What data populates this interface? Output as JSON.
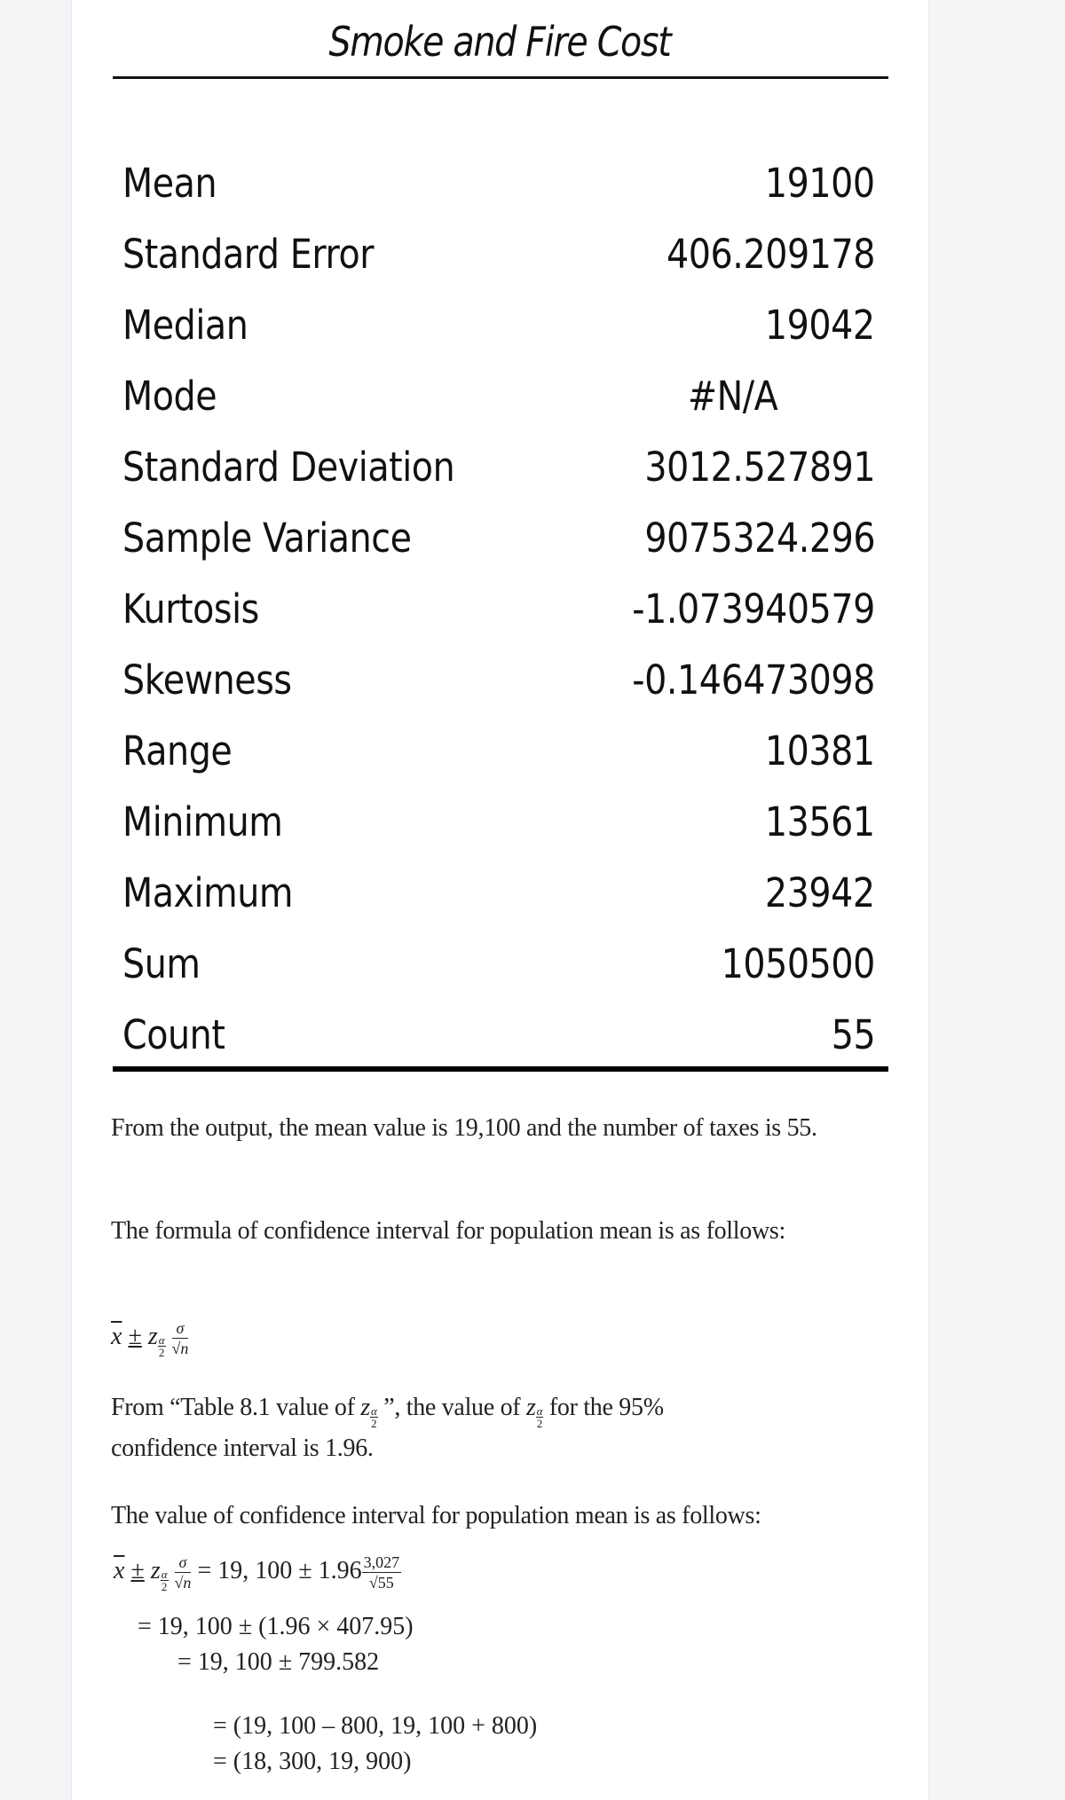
{
  "stats_table": {
    "title": "Smoke and Fire Cost",
    "rows": [
      {
        "label": "Mean",
        "value": "19100"
      },
      {
        "label": "Standard Error",
        "value": "406.209178"
      },
      {
        "label": "Median",
        "value": "19042"
      },
      {
        "label": "Mode",
        "value": "#N/A"
      },
      {
        "label": "Standard Deviation",
        "value": "3012.527891"
      },
      {
        "label": "Sample Variance",
        "value": "9075324.296"
      },
      {
        "label": "Kurtosis",
        "value": "-1.073940579"
      },
      {
        "label": "Skewness",
        "value": "-0.146473098"
      },
      {
        "label": "Range",
        "value": "10381"
      },
      {
        "label": "Minimum",
        "value": "13561"
      },
      {
        "label": "Maximum",
        "value": "23942"
      },
      {
        "label": "Sum",
        "value": "1050500"
      },
      {
        "label": "Count",
        "value": "55"
      }
    ]
  },
  "solution": {
    "para1": "From the output, the mean value is 19,100 and the number of taxes is 55.",
    "para2": "The formula of confidence interval for population mean is as follows:",
    "formula": {
      "xbar": "x",
      "pm": "±",
      "z": "z",
      "alpha": "α",
      "two": "2",
      "sigma": "σ",
      "sqrt_n": "√n"
    },
    "para3": {
      "part1": "From “Table 8.1 value of ",
      "part2": " ”, the value of ",
      "part3": " for the 95%",
      "line2": "confidence interval is 1.96."
    },
    "para4": "The value of confidence interval for population mean is as follows:",
    "calc": {
      "line1_rhs_prefix": "= 19, 100 ± 1.96",
      "line1_num": "3,027",
      "line1_den": "√55",
      "line2": "= 19, 100 ± (1.96 × 407.95)",
      "line3": "= 19, 100 ± 799.582",
      "line4": "= (19, 100 – 800, 19, 100 + 800)",
      "line5": "= (18, 300,  19, 900)"
    }
  }
}
